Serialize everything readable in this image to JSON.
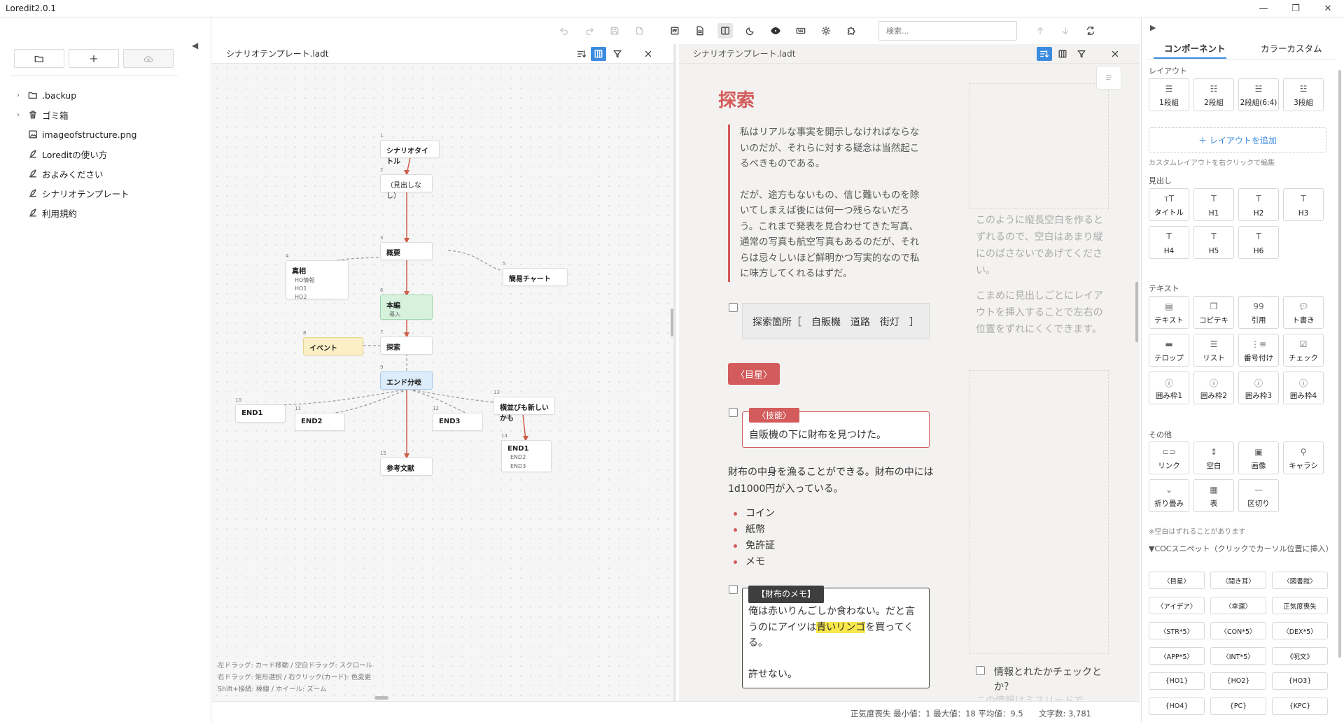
{
  "app": {
    "title": "Loredit2.0.1"
  },
  "sidebar": {
    "buttons": [
      {
        "name": "open-folder-icon"
      },
      {
        "name": "plus-icon"
      },
      {
        "name": "cloud-upload-icon"
      }
    ],
    "tree": [
      {
        "label": ".backup",
        "icon": "folder-icon",
        "chevron": true
      },
      {
        "label": "ゴミ箱",
        "icon": "trash-icon",
        "chevron": true
      },
      {
        "label": "imageofstructure.png",
        "icon": "image-icon",
        "chevron": false
      },
      {
        "label": "Loreditの使い方",
        "icon": "quill-icon",
        "chevron": false
      },
      {
        "label": "およみください",
        "icon": "quill-icon",
        "chevron": false
      },
      {
        "label": "シナリオテンプレート",
        "icon": "quill-icon",
        "chevron": false
      },
      {
        "label": "利用規約",
        "icon": "quill-icon",
        "chevron": false
      }
    ]
  },
  "toolbar": {
    "search_placeholder": "検索..."
  },
  "left_pane": {
    "filename": "シナリオテンプレート.ladt",
    "nodes": [
      {
        "num": "1",
        "title": "シナリオタイトル",
        "subs": []
      },
      {
        "num": "2",
        "title": "（見出しなし）",
        "subs": []
      },
      {
        "num": "3",
        "title": "概要",
        "subs": []
      },
      {
        "num": "4",
        "title": "真相",
        "subs": [
          "HO情報",
          "HO1",
          "HO2"
        ]
      },
      {
        "num": "5",
        "title": "簡易チャート",
        "subs": []
      },
      {
        "num": "6",
        "title": "本編",
        "subs": [
          "導入"
        ]
      },
      {
        "num": "8",
        "title": "イベント",
        "subs": []
      },
      {
        "num": "7",
        "title": "探索",
        "subs": []
      },
      {
        "num": "9",
        "title": "エンド分岐",
        "subs": []
      },
      {
        "num": "10",
        "title": "END1",
        "subs": []
      },
      {
        "num": "11",
        "title": "END2",
        "subs": []
      },
      {
        "num": "12",
        "title": "END3",
        "subs": []
      },
      {
        "num": "13",
        "title": "横並びも新しいかも",
        "subs": []
      },
      {
        "num": "14",
        "title": "END1",
        "subs": [
          "END2",
          "END3"
        ]
      },
      {
        "num": "15",
        "title": "参考文献",
        "subs": []
      }
    ],
    "help": [
      "左ドラッグ: カード移動 / 空白ドラッグ: スクロール",
      "右ドラッグ: 矩形選択 / 右クリック(カード): 色変更",
      "Shift+接続: 棒線 / ホイール: ズーム"
    ]
  },
  "right_pane": {
    "filename": "シナリオテンプレート.ladt",
    "heading": "探索",
    "quote_p1": "私はリアルな事実を開示しなければならないのだが、それらに対する疑念は当然起こるべきものである。",
    "quote_p2": "だが、途方もないもの、信じ難いものを除いてしまえば後には何一つ残らないだろう。これまで発表を見合わせてきた写真、通常の写真も航空写真もあるのだが、それらは忌々しいほど鮮明かつ写実的なので私に味方してくれるはずだ。",
    "spots": "探索箇所［　自販機　道路　街灯　］",
    "tag_meboshi": "〈目星〉",
    "skill_tag": "〈技能〉",
    "skill_text": "自販機の下に財布を見つけた。",
    "para": "財布の中身を漁ることができる。財布の中には1d1000円が入っている。",
    "list": [
      "コイン",
      "紙幣",
      "免許証",
      "メモ"
    ],
    "memo_tag": "【財布のメモ】",
    "memo_line1": "俺は赤いりんごしか食わない。だと言うのにアイツは",
    "memo_highlight": "青いリンゴ",
    "memo_line2": "を買ってくる。",
    "memo_line3": "許せない。",
    "side1": "このように縦長空白を作るとずれるので、空白はあまり縦にのばさないであげてください。",
    "side2": "こまめに見出しごとにレイアウトを挿入することで左右の位置をずれにくくできます。",
    "side_check": "情報とれたかチェックとか？",
    "side_fade": "この情報はミスリードで"
  },
  "status": {
    "sanity": "正気度喪失 最小値：1 最大値：18 平均値：9.5",
    "chars": "文字数: 3,781"
  },
  "right_panel": {
    "tabs": [
      "コンポーネント",
      "カラーカスタム"
    ],
    "layout_label": "レイアウト",
    "layout_buttons": [
      "1段組",
      "2段組",
      "2段組(6:4)",
      "3段組"
    ],
    "add_layout": "＋ レイアウトを追加",
    "custom_note": "カスタムレイアウトを右クリックで編集",
    "heading_label": "見出し",
    "heading_buttons": [
      "タイトル",
      "H1",
      "H2",
      "H3",
      "H4",
      "H5",
      "H6"
    ],
    "text_label": "テキスト",
    "text_buttons": [
      "テキスト",
      "コピテキ",
      "引用",
      "ト書き",
      "テロップ",
      "リスト",
      "番号付け",
      "チェック",
      "囲み枠1",
      "囲み枠2",
      "囲み枠3",
      "囲み枠4"
    ],
    "other_label": "その他",
    "other_buttons": [
      "リンク",
      "空白",
      "画像",
      "キャラシ",
      "折り畳み",
      "表",
      "区切り"
    ],
    "blank_note": "※空白はずれることがあります",
    "snippet_label": "▼COCスニペット（クリックでカーソル位置に挿入）",
    "snippets": [
      "〈目星〉",
      "〈聞き耳〉",
      "〈図書館〉",
      "〈アイデア〉",
      "〈幸運〉",
      "正気度喪失",
      "〈STR*5〉",
      "〈CON*5〉",
      "〈DEX*5〉",
      "〈APP*5〉",
      "〈INT*5〉",
      "《呪文》",
      "{HO1}",
      "{HO2}",
      "{HO3}",
      "{HO4}",
      "{PC}",
      "{KPC}"
    ]
  }
}
